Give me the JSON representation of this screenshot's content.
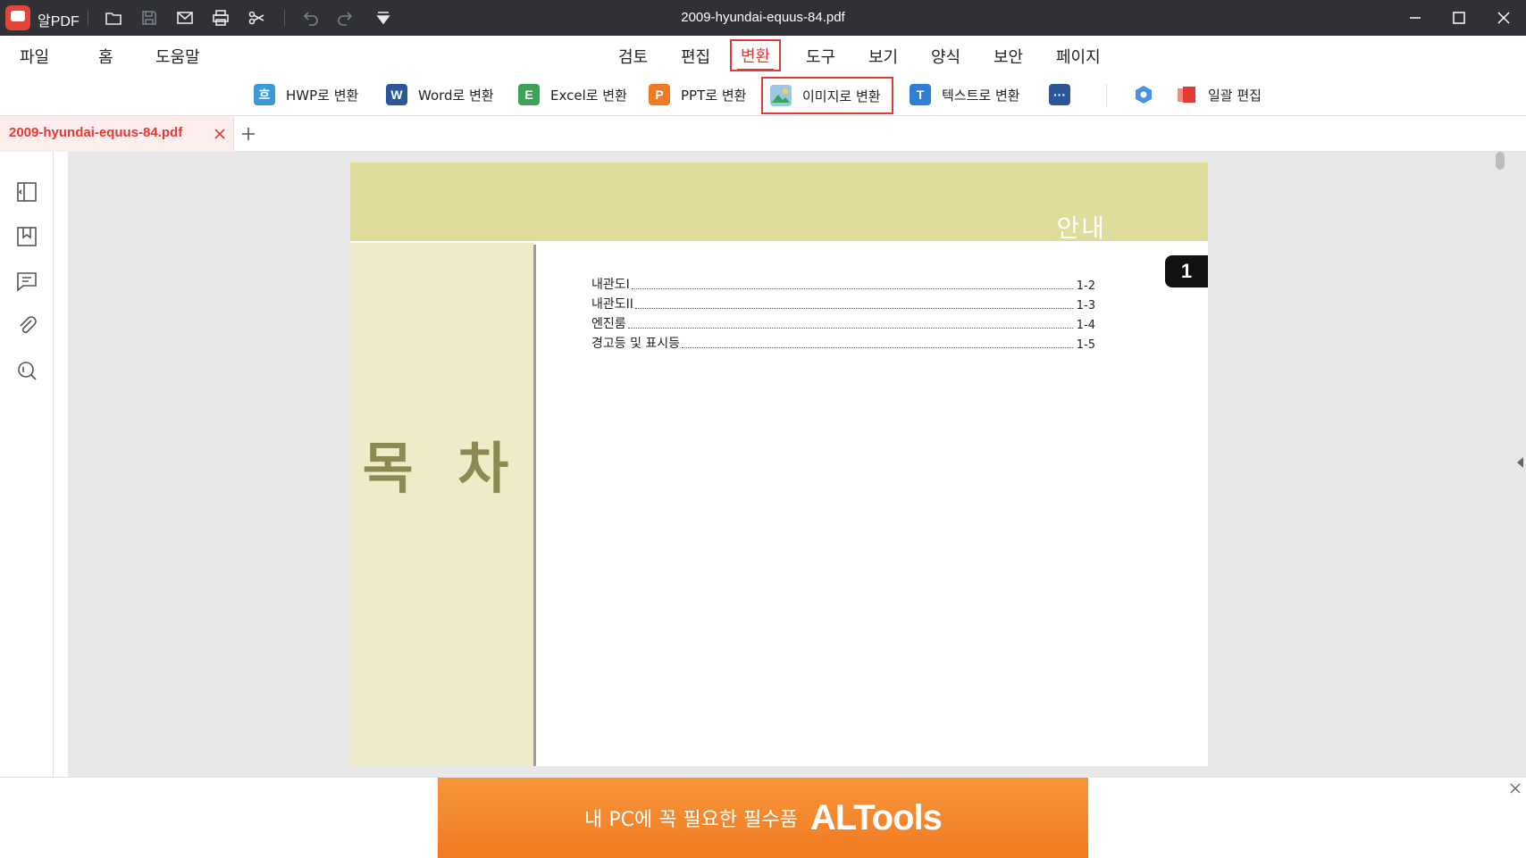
{
  "app": {
    "name": "알PDF",
    "document_title": "2009-hyundai-equus-84.pdf"
  },
  "toolbar_icons": [
    "folder-icon",
    "save-icon",
    "mail-icon",
    "print-icon",
    "scissors-icon",
    "undo-icon",
    "redo-icon",
    "customize-icon"
  ],
  "menu": {
    "left": [
      "파일",
      "홈",
      "도움말"
    ],
    "tabs": [
      "검토",
      "편집",
      "변환",
      "도구",
      "보기",
      "양식",
      "보안",
      "페이지"
    ],
    "active_tab": "변환"
  },
  "ribbon": {
    "items": [
      {
        "label": "HWP로 변환",
        "icon": "hwp-icon",
        "color": "#3a9ad9",
        "glyph": "흐"
      },
      {
        "label": "Word로 변환",
        "icon": "word-icon",
        "color": "#2b579a",
        "glyph": "W"
      },
      {
        "label": "Excel로 변환",
        "icon": "excel-icon",
        "color": "#3aa357",
        "glyph": "E"
      },
      {
        "label": "PPT로 변환",
        "icon": "ppt-icon",
        "color": "#f07a21",
        "glyph": "P"
      },
      {
        "label": "이미지로 변환",
        "icon": "image-icon",
        "color": "#4caf8a",
        "glyph": "▲"
      },
      {
        "label": "텍스트로 변환",
        "icon": "text-icon",
        "color": "#2f7fd6",
        "glyph": "T"
      },
      {
        "label": "",
        "icon": "more-formats-icon",
        "color": "#2b579a",
        "glyph": "···"
      },
      {
        "label": "",
        "icon": "settings-hex-icon",
        "color": "#4a90e2",
        "glyph": ""
      },
      {
        "label": "일괄 편집",
        "icon": "batch-edit-icon",
        "color": "#e53935",
        "glyph": ""
      }
    ],
    "highlighted": "이미지로 변환"
  },
  "tabs": {
    "open_document": "2009-hyundai-equus-84.pdf"
  },
  "sidebar_icons": [
    "panel-toggle-icon",
    "bookmark-icon",
    "comment-icon",
    "attachment-icon",
    "search-icon"
  ],
  "page": {
    "band_title": "안내",
    "side_title": "목 차",
    "badge": "1",
    "toc": [
      {
        "title": "내관도I",
        "page": "1-2"
      },
      {
        "title": "내관도II",
        "page": "1-3"
      },
      {
        "title": "엔진룸",
        "page": "1-4"
      },
      {
        "title": "경고등 및 표시등",
        "page": "1-5"
      }
    ]
  },
  "ad": {
    "text": "내 PC에 꼭 필요한 필수품",
    "brand": "ALTools"
  }
}
